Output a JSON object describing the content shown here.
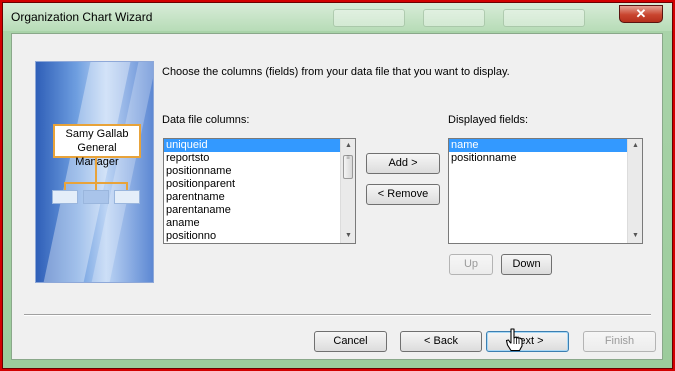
{
  "window": {
    "title": "Organization Chart Wizard",
    "close_glyph": "✕"
  },
  "graphic": {
    "manager_name": "Samy Gallab",
    "manager_title": "General Manager"
  },
  "instruction": "Choose the columns (fields) from your data file that you want to display.",
  "data_columns": {
    "label": "Data file columns:",
    "items": [
      "uniqueid",
      "reportsto",
      "positionname",
      "positionparent",
      "parentname",
      "parentaname",
      "aname",
      "positionno"
    ],
    "selected": "uniqueid"
  },
  "displayed_fields": {
    "label": "Displayed fields:",
    "items": [
      "name",
      "positionname"
    ],
    "selected": "name"
  },
  "buttons": {
    "add": "Add >",
    "remove": "< Remove",
    "up": "Up",
    "down": "Down",
    "cancel": "Cancel",
    "back": "< Back",
    "next": "Next >",
    "finish": "Finish"
  },
  "icons": {
    "close": "close-icon",
    "scroll_up": "scroll-up-icon",
    "scroll_down": "scroll-down-icon",
    "cursor": "hand-pointer-icon"
  },
  "colors": {
    "selection": "#3399ff",
    "chart_border": "#e8a33a",
    "window_chrome": "#a9d3a9",
    "highlight_frame": "#d20000"
  }
}
